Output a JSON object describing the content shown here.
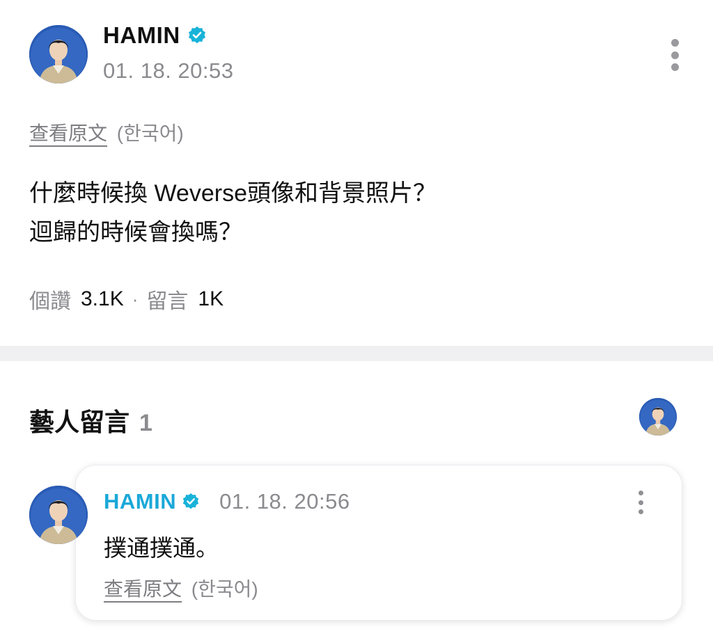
{
  "post": {
    "author": "HAMIN",
    "verified_icon": "verified-badge-icon",
    "timestamp": "01. 18. 20:53",
    "translate_link": "查看原文",
    "translate_lang": "(한국어)",
    "body_lines": [
      "什麼時候換 Weverse頭像和背景照片？",
      "迴歸的時候會換嗎？"
    ],
    "likes_label": "個讚",
    "likes_count": "3.1K",
    "separator": "·",
    "comments_label": "留言",
    "comments_count": "1K"
  },
  "artist_comments": {
    "title": "藝人留言",
    "count": "1",
    "comment": {
      "author": "HAMIN",
      "timestamp": "01. 18. 20:56",
      "text": "撲通撲通。",
      "translate_link": "查看原文",
      "translate_lang": "(한국어)"
    }
  },
  "colors": {
    "accent": "#1aa8d8",
    "verified": "#19b3d9",
    "muted": "#8a8a8f",
    "divider": "#f0f0f2"
  }
}
